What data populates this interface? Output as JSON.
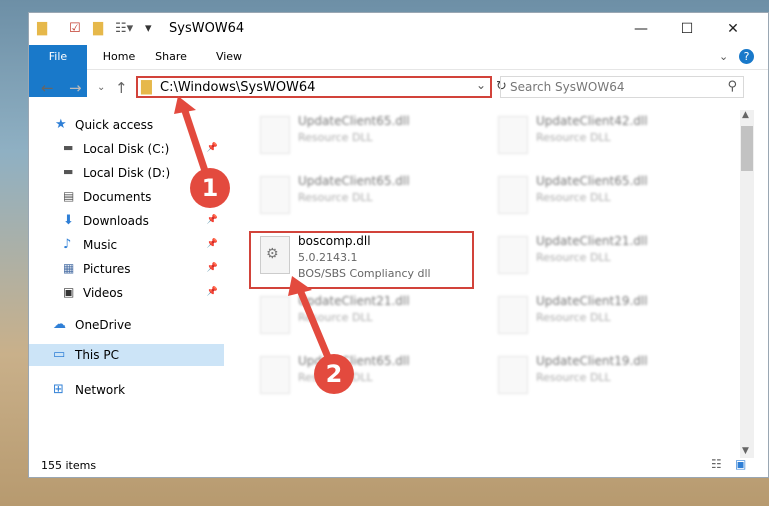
{
  "window": {
    "title": "SysWOW64",
    "help": "?"
  },
  "ribbon": {
    "tabs": [
      "File",
      "Home",
      "Share",
      "View"
    ]
  },
  "address": {
    "path": "C:\\Windows\\SysWOW64",
    "search_placeholder": "Search SysWOW64"
  },
  "sidebar": {
    "items": [
      {
        "label": "Quick access",
        "icon": "star-icon"
      },
      {
        "label": "Local Disk (C:)",
        "icon": "drive-icon"
      },
      {
        "label": "Local Disk (D:)",
        "icon": "drive-icon"
      },
      {
        "label": "Documents",
        "icon": "documents-icon"
      },
      {
        "label": "Downloads",
        "icon": "download-icon"
      },
      {
        "label": "Music",
        "icon": "music-icon"
      },
      {
        "label": "Pictures",
        "icon": "pictures-icon"
      },
      {
        "label": "Videos",
        "icon": "videos-icon"
      },
      {
        "label": "OneDrive",
        "icon": "cloud-icon"
      },
      {
        "label": "This PC",
        "icon": "computer-icon"
      },
      {
        "label": "Network",
        "icon": "network-icon"
      }
    ]
  },
  "files": [
    {
      "name": "UpdateClient65.dll",
      "desc": "Resource DLL"
    },
    {
      "name": "UpdateClient42.dll",
      "desc": "Resource DLL"
    },
    {
      "name": "UpdateClient65.dll",
      "desc": "Resource DLL"
    },
    {
      "name": "UpdateClient65.dll",
      "desc": "Resource DLL"
    },
    {
      "name": "boscomp.dll",
      "version": "5.0.2143.1",
      "desc": "BOS/SBS Compliancy dll"
    },
    {
      "name": "UpdateClient21.dll",
      "desc": "Resource DLL"
    },
    {
      "name": "UpdateClient21.dll",
      "desc": "Resource DLL"
    },
    {
      "name": "UpdateClient19.dll",
      "desc": "Resource DLL"
    },
    {
      "name": "UpdateClient65.dll",
      "desc": "Resource DLL"
    },
    {
      "name": "UpdateClient19.dll",
      "desc": "Resource DLL"
    }
  ],
  "status": {
    "count": "155 items"
  },
  "annotations": [
    "1",
    "2"
  ]
}
